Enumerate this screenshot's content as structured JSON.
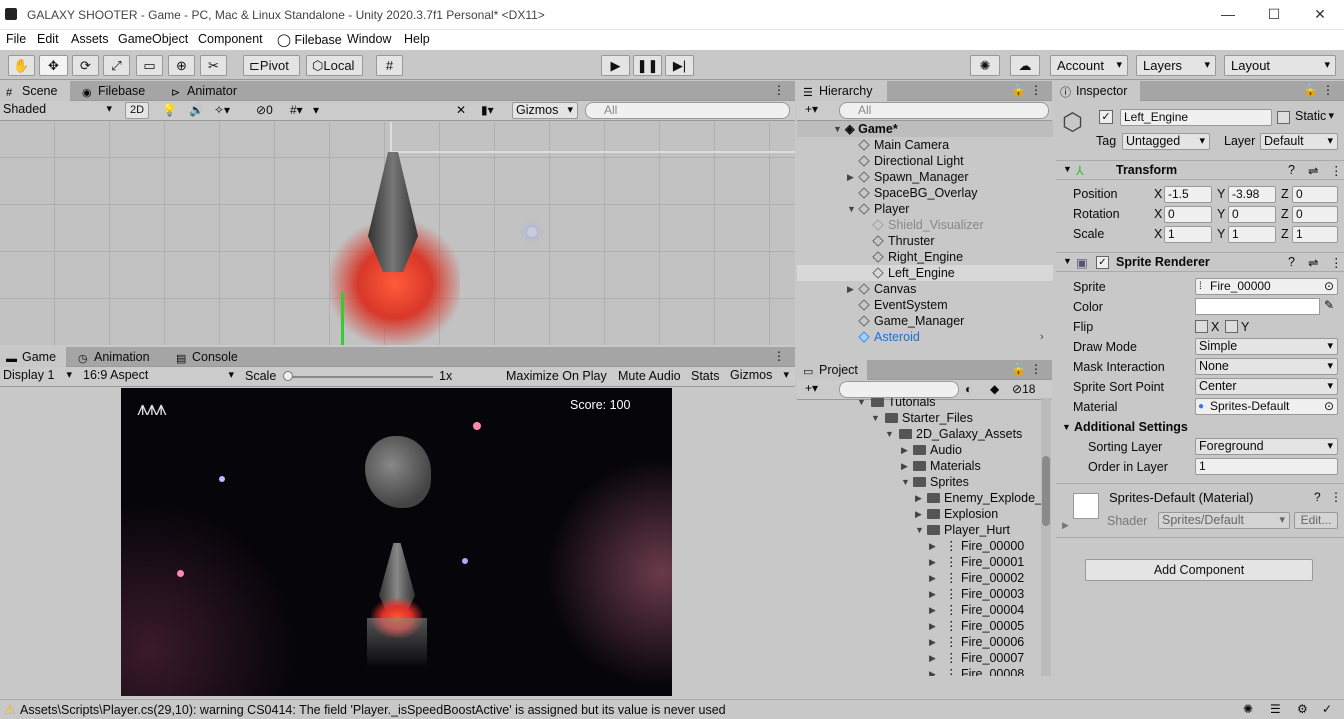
{
  "window": {
    "title": "GALAXY SHOOTER - Game - PC, Mac & Linux Standalone - Unity 2020.3.7f1 Personal* <DX11>"
  },
  "menu": [
    "File",
    "Edit",
    "Assets",
    "GameObject",
    "Component",
    "Filebase",
    "Window",
    "Help"
  ],
  "toolbar": {
    "pivot": "Pivot",
    "local": "Local",
    "account": "Account",
    "layers": "Layers",
    "layout": "Layout"
  },
  "scene": {
    "tabs": [
      "Scene",
      "Filebase",
      "Animator"
    ],
    "shading": "Shaded",
    "mode2d": "2D",
    "hidden_count": "0",
    "gizmos": "Gizmos",
    "search_placeholder": "All"
  },
  "game": {
    "tabs": [
      "Game",
      "Animation",
      "Console"
    ],
    "display": "Display 1",
    "aspect": "16:9 Aspect",
    "scale_label": "Scale",
    "scale_value": "1x",
    "buttons": [
      "Maximize On Play",
      "Mute Audio",
      "Stats",
      "Gizmos"
    ],
    "score": "Score: 100"
  },
  "hierarchy": {
    "title": "Hierarchy",
    "search_placeholder": "All",
    "scene": "Game*",
    "items": [
      "Main Camera",
      "Directional Light",
      "Spawn_Manager",
      "SpaceBG_Overlay",
      "Player",
      "Shield_Visualizer",
      "Thruster",
      "Right_Engine",
      "Left_Engine",
      "Canvas",
      "EventSystem",
      "Game_Manager",
      "Asteroid"
    ]
  },
  "project": {
    "title": "Project",
    "badge": "18",
    "items": [
      "Tutorials",
      "Starter_Files",
      "2D_Galaxy_Assets",
      "Audio",
      "Materials",
      "Sprites",
      "Enemy_Explode_S",
      "Explosion",
      "Player_Hurt",
      "Fire_00000",
      "Fire_00001",
      "Fire_00002",
      "Fire_00003",
      "Fire_00004",
      "Fire_00005",
      "Fire_00006",
      "Fire_00007",
      "Fire_00008"
    ]
  },
  "inspector": {
    "title": "Inspector",
    "object_name": "Left_Engine",
    "static": "Static",
    "tag_label": "Tag",
    "tag": "Untagged",
    "layer_label": "Layer",
    "layer": "Default",
    "transform": {
      "title": "Transform",
      "position_label": "Position",
      "rotation_label": "Rotation",
      "scale_label": "Scale",
      "position": [
        "-1.5",
        "-3.98",
        "0"
      ],
      "rotation": [
        "0",
        "0",
        "0"
      ],
      "scale": [
        "1",
        "1",
        "1"
      ],
      "axes": [
        "X",
        "Y",
        "Z"
      ]
    },
    "sprite_renderer": {
      "title": "Sprite Renderer",
      "sprite_label": "Sprite",
      "sprite": "Fire_00000",
      "color_label": "Color",
      "color": "#ffffff",
      "flip_label": "Flip",
      "flip_x": "X",
      "flip_y": "Y",
      "draw_mode_label": "Draw Mode",
      "draw_mode": "Simple",
      "mask_label": "Mask Interaction",
      "mask": "None",
      "sort_point_label": "Sprite Sort Point",
      "sort_point": "Center",
      "material_label": "Material",
      "material": "Sprites-Default",
      "additional": "Additional Settings",
      "sorting_layer_label": "Sorting Layer",
      "sorting_layer": "Foreground",
      "order_label": "Order in Layer",
      "order": "1"
    },
    "material": {
      "title": "Sprites-Default (Material)",
      "shader_label": "Shader",
      "shader": "Sprites/Default",
      "edit": "Edit..."
    },
    "add_component": "Add Component"
  },
  "status": {
    "message": "Assets\\Scripts\\Player.cs(29,10): warning CS0414: The field 'Player._isSpeedBoostActive' is assigned but its value is never used",
    "warn_color": "#f4b400"
  }
}
